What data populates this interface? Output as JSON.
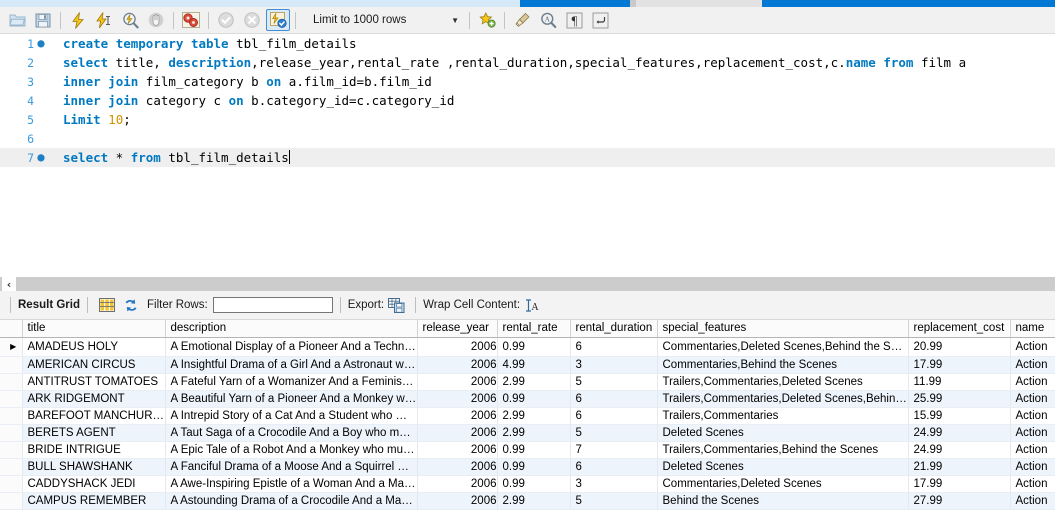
{
  "toolbar": {
    "buttons": [
      {
        "name": "open-script-icon",
        "glyph": "folder"
      },
      {
        "name": "save-script-icon",
        "glyph": "save"
      },
      {
        "name": "execute-icon",
        "glyph": "bolt"
      },
      {
        "name": "execute-statement-icon",
        "glyph": "bolt-cursor"
      },
      {
        "name": "explain-icon",
        "glyph": "magnifier-bolt"
      },
      {
        "name": "stop-icon",
        "glyph": "stop-hand"
      },
      {
        "name": "toggle-stop-on-error-icon",
        "glyph": "gears-red"
      },
      {
        "name": "commit-icon",
        "glyph": "check-gray"
      },
      {
        "name": "rollback-icon",
        "glyph": "cancel-gray"
      },
      {
        "name": "autocommit-icon",
        "glyph": "autocommit"
      },
      {
        "name": "add-snippet-icon",
        "glyph": "star-plus"
      },
      {
        "name": "beautify-icon",
        "glyph": "broom"
      },
      {
        "name": "find-icon",
        "glyph": "magnifier-a"
      },
      {
        "name": "invisible-chars-icon",
        "glyph": "pilcrow"
      },
      {
        "name": "wrap-lines-icon",
        "glyph": "wrap-arrow"
      }
    ],
    "limit_label": "Limit to 1000 rows",
    "limit_caret": "▼"
  },
  "editor": {
    "lines": [
      {
        "number": "1",
        "marker": true,
        "highlight": false,
        "tokens": [
          {
            "t": "create",
            "c": "kw"
          },
          {
            "t": " ",
            "c": ""
          },
          {
            "t": "temporary",
            "c": "kw"
          },
          {
            "t": " ",
            "c": ""
          },
          {
            "t": "table",
            "c": "kw"
          },
          {
            "t": " tbl_film_details",
            "c": ""
          }
        ]
      },
      {
        "number": "2",
        "marker": false,
        "highlight": false,
        "tokens": [
          {
            "t": "select",
            "c": "kw"
          },
          {
            "t": " title, ",
            "c": ""
          },
          {
            "t": "description",
            "c": "kw"
          },
          {
            "t": ",release_year,rental_rate ,rental_duration,special_features,replacement_cost,c.",
            "c": ""
          },
          {
            "t": "name",
            "c": "kw"
          },
          {
            "t": " ",
            "c": ""
          },
          {
            "t": "from",
            "c": "kw"
          },
          {
            "t": " film a",
            "c": ""
          }
        ]
      },
      {
        "number": "3",
        "marker": false,
        "highlight": false,
        "tokens": [
          {
            "t": "inner",
            "c": "kw"
          },
          {
            "t": " ",
            "c": ""
          },
          {
            "t": "join",
            "c": "kw"
          },
          {
            "t": " film_category b ",
            "c": ""
          },
          {
            "t": "on",
            "c": "kw"
          },
          {
            "t": " a.film_id=b.film_id",
            "c": ""
          }
        ]
      },
      {
        "number": "4",
        "marker": false,
        "highlight": false,
        "tokens": [
          {
            "t": "inner",
            "c": "kw"
          },
          {
            "t": " ",
            "c": ""
          },
          {
            "t": "join",
            "c": "kw"
          },
          {
            "t": " category c ",
            "c": ""
          },
          {
            "t": "on",
            "c": "kw"
          },
          {
            "t": " b.category_id=c.category_id",
            "c": ""
          }
        ]
      },
      {
        "number": "5",
        "marker": false,
        "highlight": false,
        "tokens": [
          {
            "t": "Limit",
            "c": "kw"
          },
          {
            "t": " ",
            "c": ""
          },
          {
            "t": "10",
            "c": "num"
          },
          {
            "t": ";",
            "c": ""
          }
        ]
      },
      {
        "number": "6",
        "marker": false,
        "highlight": false,
        "tokens": []
      },
      {
        "number": "7",
        "marker": true,
        "highlight": true,
        "caret": true,
        "tokens": [
          {
            "t": "select",
            "c": "kw"
          },
          {
            "t": " * ",
            "c": ""
          },
          {
            "t": "from",
            "c": "kw"
          },
          {
            "t": " tbl_film_details",
            "c": ""
          }
        ]
      }
    ]
  },
  "splitter": {
    "collapse_glyph": "‹"
  },
  "grid_toolbar": {
    "result_grid_label": "Result Grid",
    "grid_view_icon": "grid-view-icon",
    "refresh_icon": "refresh-icon",
    "filter_label": "Filter Rows:",
    "filter_value": "",
    "filter_placeholder": "",
    "export_label": "Export:",
    "export_icon": "export-icon",
    "wrap_label": "Wrap Cell Content:",
    "wrap_icon": "wrap-cell-icon"
  },
  "result_grid": {
    "columns": [
      "title",
      "description",
      "release_year",
      "rental_rate",
      "rental_duration",
      "special_features",
      "replacement_cost",
      "name"
    ],
    "selected_row_marker": "▶",
    "rows": [
      {
        "title": "AMADEUS HOLY",
        "description": "A Emotional Display of a Pioneer And a Technica…",
        "release_year": "2006",
        "rental_rate": "0.99",
        "rental_duration": "6",
        "special_features": "Commentaries,Deleted Scenes,Behind the Scenes",
        "replacement_cost": "20.99",
        "name": "Action"
      },
      {
        "title": "AMERICAN CIRCUS",
        "description": "A Insightful Drama of a Girl And a Astronaut wh…",
        "release_year": "2006",
        "rental_rate": "4.99",
        "rental_duration": "3",
        "special_features": "Commentaries,Behind the Scenes",
        "replacement_cost": "17.99",
        "name": "Action"
      },
      {
        "title": "ANTITRUST TOMATOES",
        "description": "A Fateful Yarn of a Womanizer And a Feminist …",
        "release_year": "2006",
        "rental_rate": "2.99",
        "rental_duration": "5",
        "special_features": "Trailers,Commentaries,Deleted Scenes",
        "replacement_cost": "11.99",
        "name": "Action"
      },
      {
        "title": "ARK RIDGEMONT",
        "description": "A Beautiful Yarn of a Pioneer And a Monkey wh…",
        "release_year": "2006",
        "rental_rate": "0.99",
        "rental_duration": "6",
        "special_features": "Trailers,Commentaries,Deleted Scenes,Behind t…",
        "replacement_cost": "25.99",
        "name": "Action"
      },
      {
        "title": "BAREFOOT MANCHURIAN",
        "description": "A Intrepid Story of a Cat And a Student who m…",
        "release_year": "2006",
        "rental_rate": "2.99",
        "rental_duration": "6",
        "special_features": "Trailers,Commentaries",
        "replacement_cost": "15.99",
        "name": "Action"
      },
      {
        "title": "BERETS AGENT",
        "description": "A Taut Saga of a Crocodile And a Boy who must…",
        "release_year": "2006",
        "rental_rate": "2.99",
        "rental_duration": "5",
        "special_features": "Deleted Scenes",
        "replacement_cost": "24.99",
        "name": "Action"
      },
      {
        "title": "BRIDE INTRIGUE",
        "description": "A Epic Tale of a Robot And a Monkey who must …",
        "release_year": "2006",
        "rental_rate": "0.99",
        "rental_duration": "7",
        "special_features": "Trailers,Commentaries,Behind the Scenes",
        "replacement_cost": "24.99",
        "name": "Action"
      },
      {
        "title": "BULL SHAWSHANK",
        "description": "A Fanciful Drama of a Moose And a Squirrel who…",
        "release_year": "2006",
        "rental_rate": "0.99",
        "rental_duration": "6",
        "special_features": "Deleted Scenes",
        "replacement_cost": "21.99",
        "name": "Action"
      },
      {
        "title": "CADDYSHACK JEDI",
        "description": "A Awe-Inspiring Epistle of a Woman And a Mad…",
        "release_year": "2006",
        "rental_rate": "0.99",
        "rental_duration": "3",
        "special_features": "Commentaries,Deleted Scenes",
        "replacement_cost": "17.99",
        "name": "Action"
      },
      {
        "title": "CAMPUS REMEMBER",
        "description": "A Astounding Drama of a Crocodile And a Mad …",
        "release_year": "2006",
        "rental_rate": "2.99",
        "rental_duration": "5",
        "special_features": "Behind the Scenes",
        "replacement_cost": "27.99",
        "name": "Action"
      }
    ]
  }
}
